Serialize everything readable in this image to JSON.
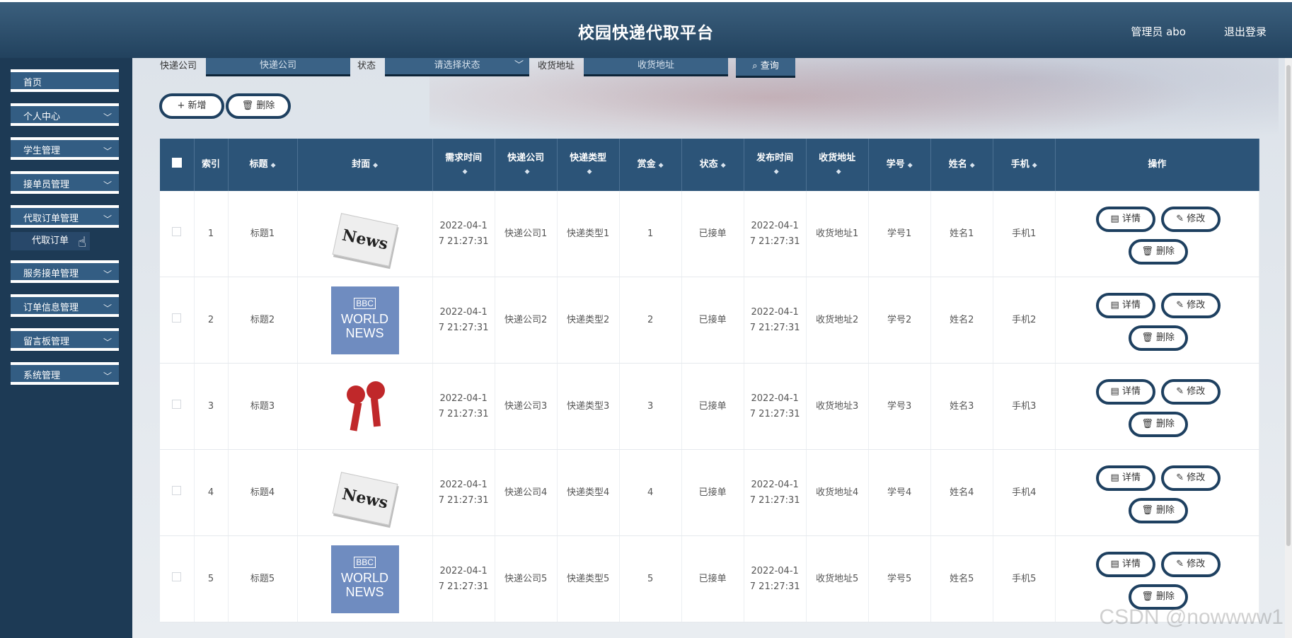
{
  "header": {
    "title": "校园快递代取平台",
    "user": "管理员 abo",
    "logout": "退出登录"
  },
  "sidebar": {
    "items": [
      {
        "label": "首页",
        "chevron": false
      },
      {
        "label": "个人中心",
        "chevron": true
      },
      {
        "label": "学生管理",
        "chevron": true
      },
      {
        "label": "接单员管理",
        "chevron": true
      },
      {
        "label": "代取订单管理",
        "chevron": true
      },
      {
        "label": "服务接单管理",
        "chevron": true
      },
      {
        "label": "订单信息管理",
        "chevron": true
      },
      {
        "label": "留言板管理",
        "chevron": true
      },
      {
        "label": "系统管理",
        "chevron": true
      }
    ],
    "submenu_label": "代取订单"
  },
  "filters": {
    "company_label": "快递公司",
    "company_placeholder": "快递公司",
    "status_label": "状态",
    "status_placeholder": "请选择状态",
    "address_label": "收货地址",
    "address_placeholder": "收货地址",
    "search_label": "查询"
  },
  "actions": {
    "add_label": "新增",
    "delete_label": "删除"
  },
  "table": {
    "headers": {
      "index": "索引",
      "title": "标题",
      "cover": "封面",
      "need_time": "需求时间",
      "company": "快递公司",
      "type": "快递类型",
      "reward": "赏金",
      "status": "状态",
      "publish_time": "发布时间",
      "address": "收货地址",
      "student_no": "学号",
      "name": "姓名",
      "phone": "手机",
      "ops": "操作"
    },
    "rows": [
      {
        "index": "1",
        "title": "标题1",
        "cover": "news",
        "need_time_1": "2022-04-1",
        "need_time_2": "7 21:27:31",
        "company": "快递公司1",
        "type": "快递类型1",
        "reward": "1",
        "status": "已接单",
        "publish_time_1": "2022-04-1",
        "publish_time_2": "7 21:27:31",
        "address": "收货地址1",
        "student_no": "学号1",
        "name": "姓名1",
        "phone": "手机1"
      },
      {
        "index": "2",
        "title": "标题2",
        "cover": "bbc",
        "need_time_1": "2022-04-1",
        "need_time_2": "7 21:27:31",
        "company": "快递公司2",
        "type": "快递类型2",
        "reward": "2",
        "status": "已接单",
        "publish_time_1": "2022-04-1",
        "publish_time_2": "7 21:27:31",
        "address": "收货地址2",
        "student_no": "学号2",
        "name": "姓名2",
        "phone": "手机2"
      },
      {
        "index": "3",
        "title": "标题3",
        "cover": "mic",
        "need_time_1": "2022-04-1",
        "need_time_2": "7 21:27:31",
        "company": "快递公司3",
        "type": "快递类型3",
        "reward": "3",
        "status": "已接单",
        "publish_time_1": "2022-04-1",
        "publish_time_2": "7 21:27:31",
        "address": "收货地址3",
        "student_no": "学号3",
        "name": "姓名3",
        "phone": "手机3"
      },
      {
        "index": "4",
        "title": "标题4",
        "cover": "news",
        "need_time_1": "2022-04-1",
        "need_time_2": "7 21:27:31",
        "company": "快递公司4",
        "type": "快递类型4",
        "reward": "4",
        "status": "已接单",
        "publish_time_1": "2022-04-1",
        "publish_time_2": "7 21:27:31",
        "address": "收货地址4",
        "student_no": "学号4",
        "name": "姓名4",
        "phone": "手机4"
      },
      {
        "index": "5",
        "title": "标题5",
        "cover": "bbc",
        "need_time_1": "2022-04-1",
        "need_time_2": "7 21:27:31",
        "company": "快递公司5",
        "type": "快递类型5",
        "reward": "5",
        "status": "已接单",
        "publish_time_1": "2022-04-1",
        "publish_time_2": "7 21:27:31",
        "address": "收货地址5",
        "student_no": "学号5",
        "name": "姓名5",
        "phone": "手机5"
      }
    ],
    "op_labels": {
      "detail": "详情",
      "edit": "修改",
      "delete": "删除"
    }
  },
  "cover_text": {
    "news": "News",
    "bbc_box": "BBC",
    "bbc_1": "WORLD",
    "bbc_2": "NEWS"
  },
  "watermark": "CSDN @nowwww1"
}
